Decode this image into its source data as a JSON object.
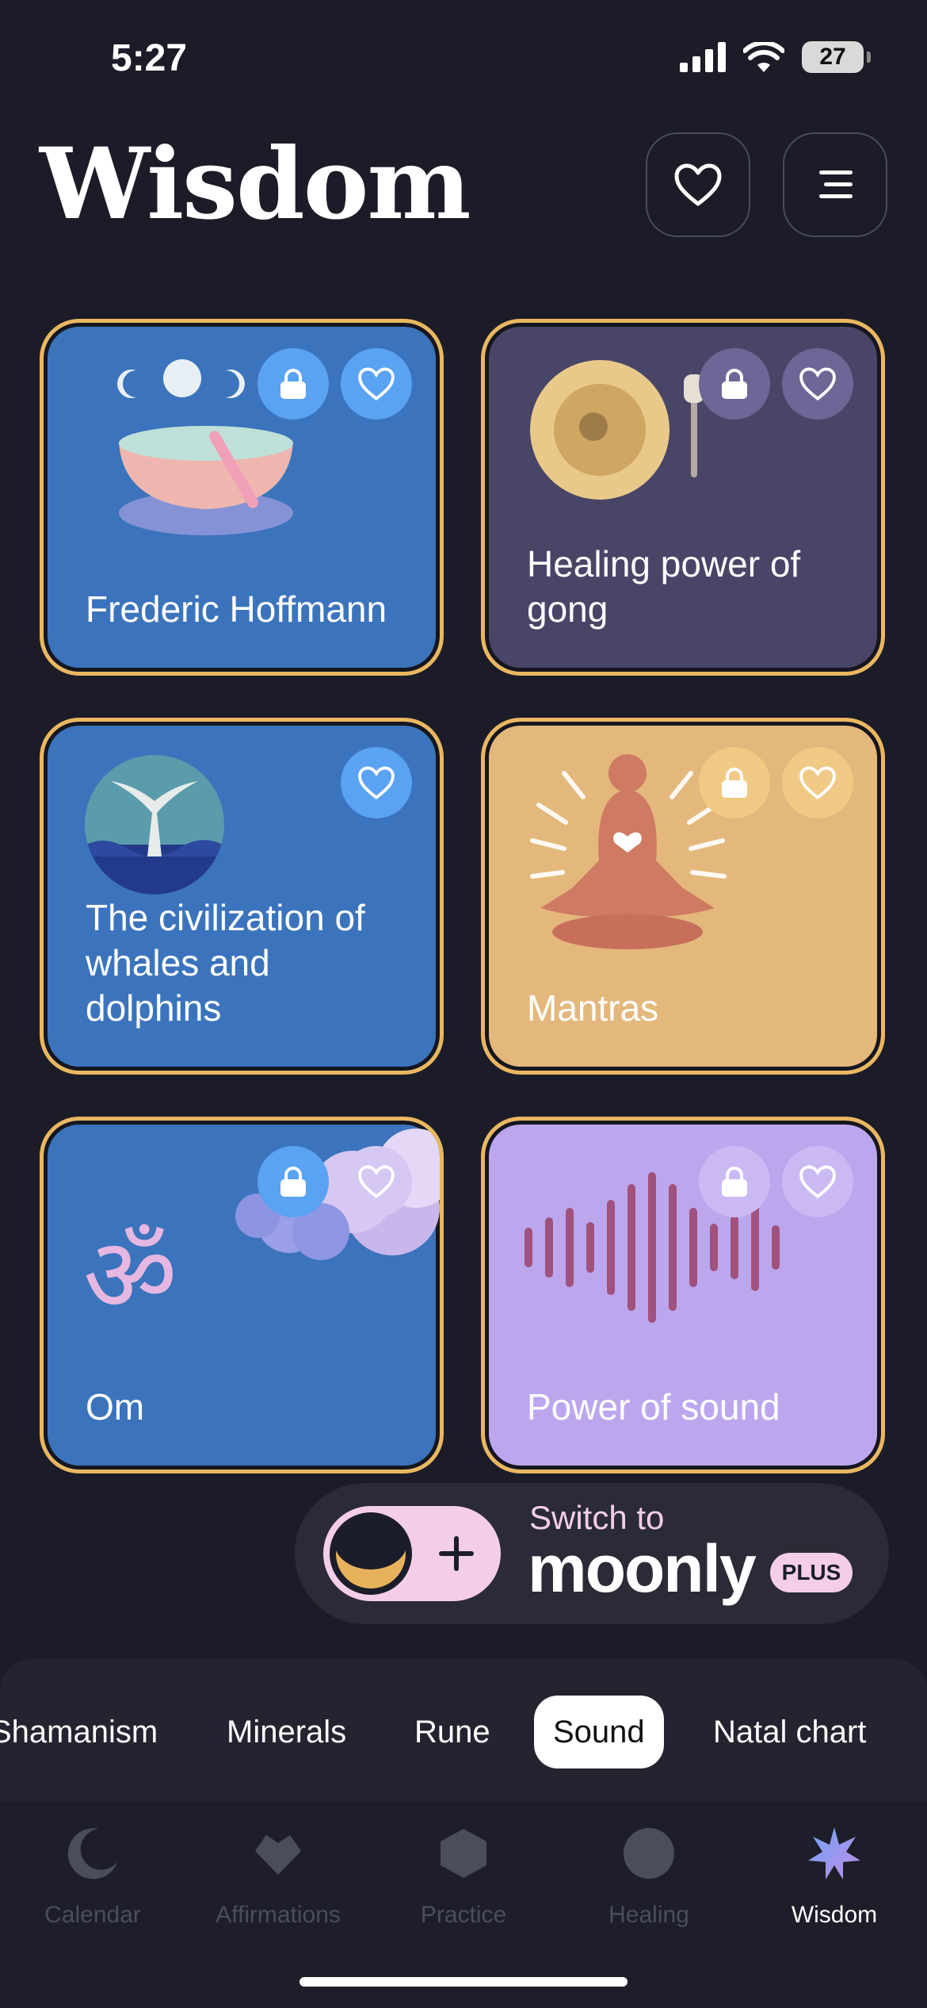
{
  "status": {
    "time": "5:27",
    "battery": "27"
  },
  "header": {
    "title": "Wisdom"
  },
  "cards": [
    {
      "title": "Frederic Hoffmann",
      "locked": true
    },
    {
      "title": "Healing power of gong",
      "locked": true
    },
    {
      "title": "The civilization of whales and dolphins",
      "locked": false
    },
    {
      "title": "Mantras",
      "locked": true
    },
    {
      "title": "Om",
      "locked": true,
      "glyph": "ॐ"
    },
    {
      "title": "Power of sound",
      "locked": true
    }
  ],
  "promo": {
    "line1": "Switch to",
    "brand": "moonly",
    "badge": "PLUS"
  },
  "categories": [
    {
      "label": "Shamanism",
      "active": false
    },
    {
      "label": "Minerals",
      "active": false
    },
    {
      "label": "Rune",
      "active": false
    },
    {
      "label": "Sound",
      "active": true
    },
    {
      "label": "Natal chart",
      "active": false
    }
  ],
  "tabs": [
    {
      "label": "Calendar",
      "icon": "moon-icon"
    },
    {
      "label": "Affirmations",
      "icon": "heart-icon"
    },
    {
      "label": "Practice",
      "icon": "hexagon-icon"
    },
    {
      "label": "Healing",
      "icon": "circle-icon"
    },
    {
      "label": "Wisdom",
      "icon": "star-icon",
      "active": true
    }
  ],
  "colors": {
    "background": "#1b1c27",
    "card_border": "#eab760",
    "blue_card": "#3b74bc",
    "purple_card": "#484567",
    "mantra_card": "#e4b87c",
    "sound_card": "#bca7ef",
    "promo_pink": "#f3cdea"
  }
}
